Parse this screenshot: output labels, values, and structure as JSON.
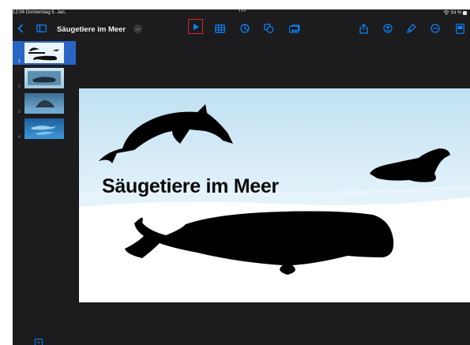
{
  "status_bar": {
    "time_date": "12:04  Donnerstag 5. Jan.",
    "battery": "54 %"
  },
  "toolbar": {
    "document_title": "Säugetiere im Meer",
    "left_icons": [
      "back-chevron-icon",
      "sidebar-toggle-icon"
    ],
    "center_icons": [
      "play-icon",
      "table-icon",
      "chart-icon",
      "shapes-icon",
      "media-icon"
    ],
    "right_icons": [
      "share-icon",
      "collaborate-icon",
      "format-brush-icon",
      "more-icon",
      "presenter-icon"
    ],
    "accent_color": "#0a84ff",
    "highlight_color": "#e0242a"
  },
  "navigator": {
    "slides": [
      {
        "number": "1",
        "selected": true,
        "description": "title-slide-thumb"
      },
      {
        "number": "2",
        "selected": false,
        "description": "whale-photo-thumb"
      },
      {
        "number": "3",
        "selected": false,
        "description": "seal-photo-thumb"
      },
      {
        "number": "4",
        "selected": false,
        "description": "dolphin-photo-thumb"
      }
    ],
    "add_icon": "add-slide-icon"
  },
  "slide": {
    "title": "Säugetiere im Meer",
    "background_top": "#c9e6f5",
    "background_bottom": "#ffffff"
  }
}
